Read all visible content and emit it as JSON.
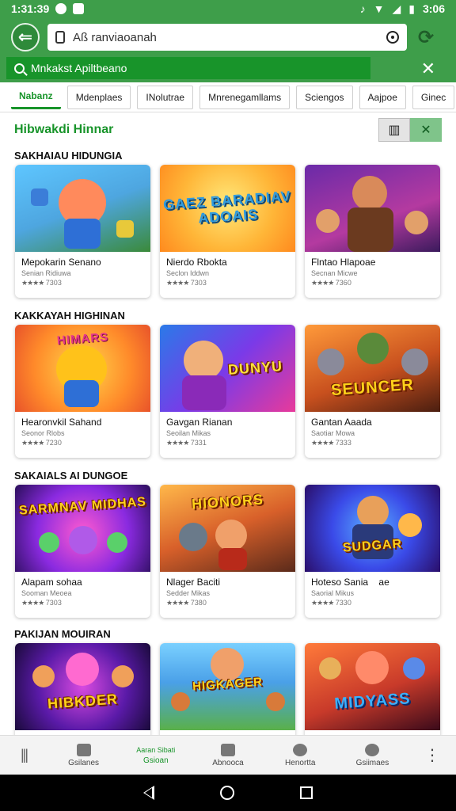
{
  "statusbar": {
    "time": "1:31:39",
    "battery": "3:06"
  },
  "toolbar": {
    "url": "Aß ranviaoanah"
  },
  "searchstrip": {
    "query": "Mnkakst Apiltbeano"
  },
  "tabs": [
    "Nabanz",
    "Mdenplaes",
    "INolutrae",
    "Mnrenegamllams",
    "Sciengos",
    "Aajpoe",
    "Ginec"
  ],
  "page": {
    "title": "Hibwakdi Hinnar"
  },
  "sections": [
    {
      "title": "SAKHAIAU HIDUNGIA",
      "cards": [
        {
          "name": "Mepokarin Senano",
          "sub": "Senian Ridiuwa",
          "rating": "7303"
        },
        {
          "name": "Nierdo Rbokta",
          "sub": "Seclon Iddwn",
          "rating": "7303",
          "art": "GAEZ BARADIAV ADOAIS"
        },
        {
          "name": "Flntao Hlapoae",
          "sub": "Secnan Micwe",
          "rating": "7360",
          "art": ""
        }
      ]
    },
    {
      "title": "KAKKAYAH HIGHINAN",
      "cards": [
        {
          "name": "Hearonvkil Sahand",
          "sub": "Seonor Rlobs",
          "rating": "7230",
          "art": "HIMARS"
        },
        {
          "name": "Gavgan Rianan",
          "sub": "Seoilan Mikas",
          "rating": "7331",
          "art": "DUNYU"
        },
        {
          "name": "Gantan Aaada",
          "sub": "Saotiar Mowa",
          "rating": "7333",
          "art": "SEUNCER"
        }
      ]
    },
    {
      "title": "SAKAIALS AI DUNGOE",
      "cards": [
        {
          "name": "Alapam sohaa",
          "sub": "Sooman Meoea",
          "rating": "7303",
          "art": "SARMNAV MIDHAS"
        },
        {
          "name": "Nlager Baciti",
          "sub": "Sedder Mikas",
          "rating": "7380",
          "art": "HIONORS"
        },
        {
          "name": "Hoteso Sania",
          "sub": "Saorial Mikus",
          "rating": "7330",
          "extra": "ae",
          "art": "SUDGAR"
        }
      ]
    },
    {
      "title": "PAKIJAN MOUIRAN",
      "cards": [
        {
          "name": "",
          "sub": "",
          "rating": "",
          "art": "HIBKDER"
        },
        {
          "name": "",
          "sub": "",
          "rating": "",
          "art": "HIGKAGER"
        },
        {
          "name": "",
          "sub": "",
          "rating": "",
          "art": "MIDYASS"
        }
      ]
    }
  ],
  "bottomnav": [
    {
      "label": ""
    },
    {
      "label": "Gsilanes"
    },
    {
      "label": "Gsioan",
      "top": "Aaran Sibati"
    },
    {
      "label": "Abnooca"
    },
    {
      "label": "Henortta"
    },
    {
      "label": "Gsiimaes"
    },
    {
      "label": "⋮"
    }
  ],
  "colors": {
    "accent": "#18942a",
    "toolbar": "#3e9e4a"
  }
}
